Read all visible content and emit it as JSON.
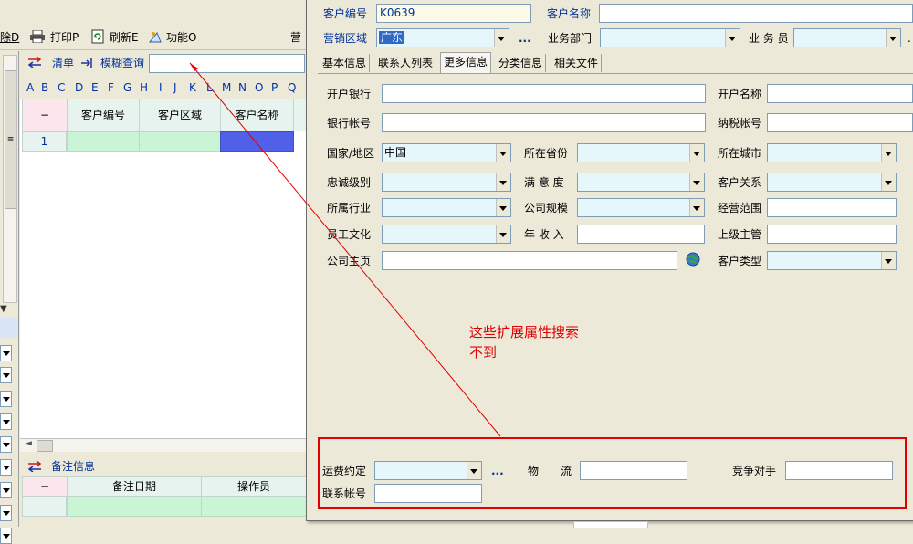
{
  "left_toolbar": {
    "delete_label": "除D",
    "print_label": "打印P",
    "refresh_label": "刷新E",
    "function_label": "功能O",
    "marketing_label": "营"
  },
  "list_bar": {
    "list_label": "清单",
    "fuzzy_label": "模糊查询",
    "search_value": ""
  },
  "letters": [
    "A",
    "B",
    "C",
    "D",
    "E",
    "F",
    "G",
    "H",
    "I",
    "J",
    "K",
    "L",
    "M",
    "N",
    "O",
    "P",
    "Q"
  ],
  "grid": {
    "corner": "−",
    "columns": [
      "客户编号",
      "客户区域",
      "客户名称"
    ],
    "rows": [
      {
        "num": "1"
      }
    ]
  },
  "notes": {
    "title": "备注信息",
    "corner": "−",
    "columns": [
      "备注日期",
      "操作员"
    ]
  },
  "form": {
    "customer_no_label": "客户编号",
    "customer_no": "K0639",
    "customer_name_label": "客户名称",
    "customer_name": "",
    "region_label": "营销区域",
    "region_value": "广东",
    "ellipsis": "...",
    "dept_label": "业务部门",
    "staff_label": "业 务 员"
  },
  "tabs": [
    "基本信息",
    "联系人列表",
    "更多信息",
    "分类信息",
    "相关文件"
  ],
  "more": {
    "bank_label": "开户银行",
    "account_name_label": "开户名称",
    "bank_account_label": "银行帐号",
    "tax_label": "纳税帐号",
    "country_label": "国家/地区",
    "country_value": "中国",
    "province_label": "所在省份",
    "city_label": "所在城市",
    "loyalty_label": "忠诚级别",
    "satisfaction_label": "满 意 度",
    "relation_label": "客户关系",
    "industry_label": "所属行业",
    "scale_label": "公司规模",
    "scope_label": "经营范围",
    "culture_label": "员工文化",
    "income_label": "年 收 入",
    "supervisor_label": "上级主管",
    "homepage_label": "公司主页",
    "type_label": "客户类型"
  },
  "annotation": {
    "text": "这些扩展属性搜索不到",
    "color": "#e00000"
  },
  "ext": {
    "freight_label": "运费约定",
    "ellipsis": "...",
    "logistics_label": "物　　流",
    "competitor_label": "竞争对手",
    "contact_account_label": "联系帐号"
  }
}
